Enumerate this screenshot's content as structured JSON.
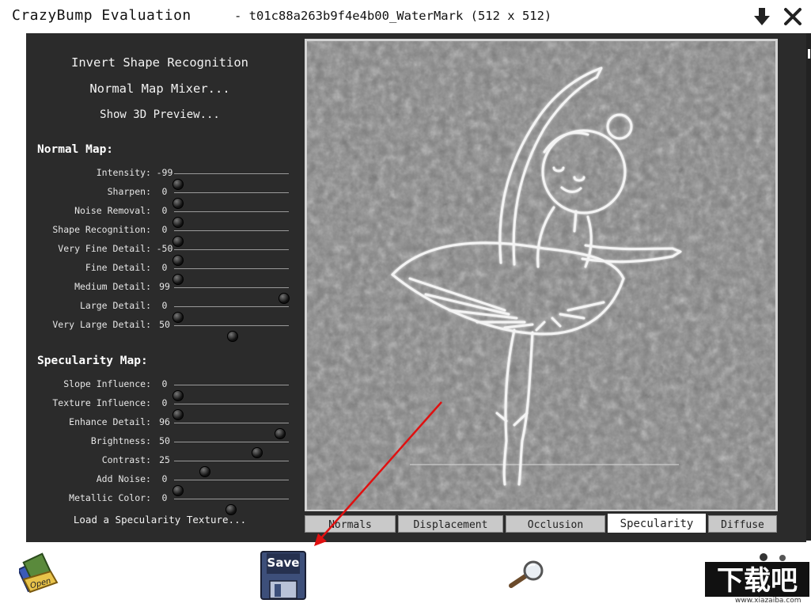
{
  "window": {
    "app_title": "CrazyBump Evaluation",
    "file_title": "- t01c88a263b9f4e4b00_WaterMark (512 x 512)",
    "icons": [
      "download-arrow-icon",
      "close-icon"
    ]
  },
  "sidebar": {
    "actions": [
      {
        "label": "Invert Shape Recognition"
      },
      {
        "label": "Normal Map Mixer..."
      },
      {
        "label": "Show 3D Preview..."
      }
    ],
    "normal_map": {
      "title": "Normal Map:",
      "sliders": [
        {
          "label": "Intensity:",
          "value": "-99",
          "pos": 0.03
        },
        {
          "label": "Sharpen:",
          "value": "0",
          "pos": 0.03
        },
        {
          "label": "Noise Removal:",
          "value": "0",
          "pos": 0.03
        },
        {
          "label": "Shape Recognition:",
          "value": "0",
          "pos": 0.03
        },
        {
          "label": "Very Fine Detail:",
          "value": "-50",
          "pos": 0.03
        },
        {
          "label": "Fine Detail:",
          "value": "0",
          "pos": 0.03
        },
        {
          "label": "Medium Detail:",
          "value": "99",
          "pos": 0.95
        },
        {
          "label": "Large Detail:",
          "value": "0",
          "pos": 0.03
        },
        {
          "label": "Very Large Detail:",
          "value": "50",
          "pos": 0.5
        }
      ]
    },
    "specularity_map": {
      "title": "Specularity Map:",
      "sliders": [
        {
          "label": "Slope Influence:",
          "value": "0",
          "pos": 0.03
        },
        {
          "label": "Texture Influence:",
          "value": "0",
          "pos": 0.03
        },
        {
          "label": "Enhance Detail:",
          "value": "96",
          "pos": 0.92
        },
        {
          "label": "Brightness:",
          "value": "50",
          "pos": 0.72
        },
        {
          "label": "Contrast:",
          "value": "25",
          "pos": 0.26
        },
        {
          "label": "Add Noise:",
          "value": "0",
          "pos": 0.03
        },
        {
          "label": "Metallic Color:",
          "value": "0",
          "pos": 0.49
        }
      ],
      "load_texture_label": "Load a Specularity Texture..."
    }
  },
  "preview": {
    "icon": "ballerina-specularity-preview"
  },
  "tabs": [
    {
      "label": "Normals",
      "active": false
    },
    {
      "label": "Displacement",
      "active": false
    },
    {
      "label": "Occlusion",
      "active": false
    },
    {
      "label": "Specularity",
      "active": true
    },
    {
      "label": "Diffuse",
      "active": false
    }
  ],
  "toolbar": {
    "open_label": "Open",
    "save_label": "Save",
    "icons": [
      "open-folder-icon",
      "save-disk-icon",
      "magnifier-icon"
    ]
  },
  "watermark": {
    "logo_text": "下载吧",
    "url_text": "www.xiazaiba.com"
  },
  "colors": {
    "panel": "#2b2b2b",
    "annotation_arrow": "#e01010"
  }
}
